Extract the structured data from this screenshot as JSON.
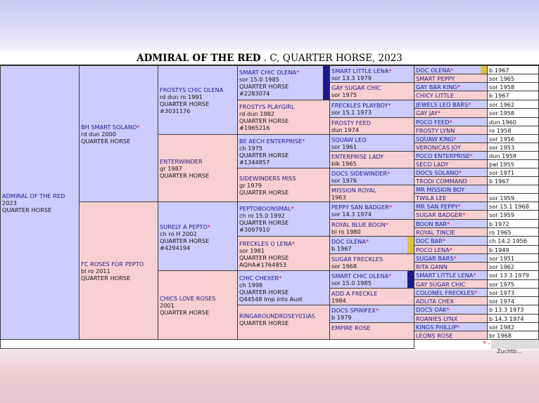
{
  "title": {
    "name": "ADMIRAL OF THE RED",
    "rest": " . C, QUARTER HORSE, 2023"
  },
  "footer": {
    "marker": "* -",
    "partial": "Zuchtb..."
  },
  "g1": {
    "name": "ADMIRAL OF THE RED",
    "l1": "2023",
    "l2": "QUARTER HORSE"
  },
  "g2": [
    {
      "name": "BH SMART SOLANO",
      "l1": "rd dun 2000",
      "l2": "QUARTER HORSE"
    },
    {
      "name": "FC ROSES FOR PEPTO",
      "l1": "bl ro 2011",
      "l2": "QUARTER HORSE"
    }
  ],
  "g3": [
    {
      "name": "FROSTYS CHIC OLENA",
      "l1": "rd dun ro 1991",
      "l2": "QUARTER HORSE",
      "l3": "#3031176"
    },
    {
      "name": "ENTERWINDER",
      "l1": "gr 1987",
      "l2": "QUARTER HORSE"
    },
    {
      "name": "SURELY A PEPTO",
      "l1": "ch ro H 2002",
      "l2": "QUARTER HORSE",
      "l3": "#4294194"
    },
    {
      "name": "CHICS LOVE ROSES",
      "l1": "2001",
      "l2": "QUARTER HORSE"
    }
  ],
  "g4": [
    {
      "name": "SMART CHIC OLENA",
      "l1": "sor 15.0 1985",
      "l2": "QUARTER HORSE",
      "l3": "#2283074"
    },
    {
      "name": "FROSTYS PLAYGIRL",
      "l1": "rd dun 1982",
      "l2": "QUARTER HORSE",
      "l3": "#1965216"
    },
    {
      "name": "BE AECH ENTERPRISE",
      "l1": "ch 1975",
      "l2": "QUARTER HORSE",
      "l3": "#1344857"
    },
    {
      "name": "SIDEWINDERS MISS",
      "l1": "gr 1979",
      "l2": "QUARTER HORSE"
    },
    {
      "name": "PEPTOBOONSMAL",
      "l1": "ch ro 15.0 1992",
      "l2": "QUARTER HORSE",
      "l3": "#3097910"
    },
    {
      "name": "FRECKLES O LENA",
      "l1": "sor 1981",
      "l2": "QUARTER HORSE",
      "l3": "AQHA#1764853"
    },
    {
      "name": "CHIC CHEXER",
      "l1": "ch 1998",
      "l2": "QUARTER HORSE",
      "l3": "Q44548 Imp into Aust"
    },
    {
      "name": "RINGAROUNDROSEY01IAS",
      "l1": "",
      "l2": "QUARTER HORSE"
    }
  ],
  "g5": [
    {
      "name": "SMART LITTLE LENA",
      "l1": "sor 13.3 1979"
    },
    {
      "name": "GAY SUGAR CHIC",
      "l1": "sor 1975"
    },
    {
      "name": "FRECKLES PLAYBOY",
      "l1": "sor 15.1 1973"
    },
    {
      "name": "FROSTY FEED",
      "l1": "dun 1974"
    },
    {
      "name": "SQUAW LEO",
      "l1": "sor 1961"
    },
    {
      "name": "ENTERPRISE LADY",
      "l1": "blk 1965"
    },
    {
      "name": "DOCS SIDEWINDER",
      "l1": "sor 1976"
    },
    {
      "name": "MISSION ROYAL",
      "l1": "1963"
    },
    {
      "name": "PEPPY SAN BADGER",
      "l1": "sor 14.3 1974"
    },
    {
      "name": "ROYAL BLUE BOON",
      "l1": "bl ro 1980"
    },
    {
      "name": "DOC OLENA",
      "l1": "b 1967"
    },
    {
      "name": "SUGAR FRECKLES",
      "l1": "sor 1968"
    },
    {
      "name": "SMART CHIC OLENA",
      "l1": "sor 15.0 1985"
    },
    {
      "name": "ADD A FRECKLE",
      "l1": "1984"
    },
    {
      "name": "DOCS SPINIFEX",
      "l1": "b 1979"
    },
    {
      "name": "EMPIRE ROSE",
      "l1": ""
    }
  ],
  "g6": [
    {
      "name": "DOC OLENA",
      "info": "b 1967"
    },
    {
      "name": "SMART PEPPY",
      "info": "sor 1965"
    },
    {
      "name": "GAY BAR KING",
      "info": "sor 1958"
    },
    {
      "name": "CHICY LITTLE",
      "info": "b 1967"
    },
    {
      "name": "JEWELS LEO BARS",
      "info": "sor 1962"
    },
    {
      "name": "GAY JAY",
      "info": "sor 1958"
    },
    {
      "name": "POCO FEED",
      "info": "dun 1960"
    },
    {
      "name": "FROSTY LYNN",
      "info": "ro 1958"
    },
    {
      "name": "SQUAW KING",
      "info": "sor 1956"
    },
    {
      "name": "VERONICAS JOY",
      "info": "sor 1953"
    },
    {
      "name": "POCO ENTERPRISE",
      "info": "dun 1958"
    },
    {
      "name": "SECO LADY",
      "info": "pal 1955"
    },
    {
      "name": "DOCS SOLANO",
      "info": "sor 1971"
    },
    {
      "name": "TRODI COMMAND",
      "info": "b 1967"
    },
    {
      "name": "MR MISSION BOY",
      "info": ""
    },
    {
      "name": "TWILA LEE",
      "info": "sor 1959"
    },
    {
      "name": "MR SAN PEPPY",
      "info": "sor 15.1 1968"
    },
    {
      "name": "SUGAR BADGER",
      "info": "sor 1959"
    },
    {
      "name": "BOON BAR",
      "info": "b 1972"
    },
    {
      "name": "ROYAL TINCIE",
      "info": "ro 1965"
    },
    {
      "name": "DOC BAR",
      "info": "ch 14.2 1956"
    },
    {
      "name": "POCO LENA",
      "info": "b 1949"
    },
    {
      "name": "SUGAR BARS",
      "info": "sor 1951"
    },
    {
      "name": "RITA GANN",
      "info": "sor 1962"
    },
    {
      "name": "SMART LITTLE LENA",
      "info": "sor 13.3 1979"
    },
    {
      "name": "GAY SUGAR CHIC",
      "info": "sor 1975"
    },
    {
      "name": "COLONEL FRECKLES",
      "info": "sor 1973"
    },
    {
      "name": "ADLITA CHEX",
      "info": "sor 1974"
    },
    {
      "name": "DOCS OAK",
      "info": "b 13.3 1973"
    },
    {
      "name": "ROANIES LYNX",
      "info": "b 14.3 1974"
    },
    {
      "name": "KINGS PHILLIP",
      "info": "sor 1982"
    },
    {
      "name": "LEONS ROSE",
      "info": "br 1968"
    }
  ]
}
